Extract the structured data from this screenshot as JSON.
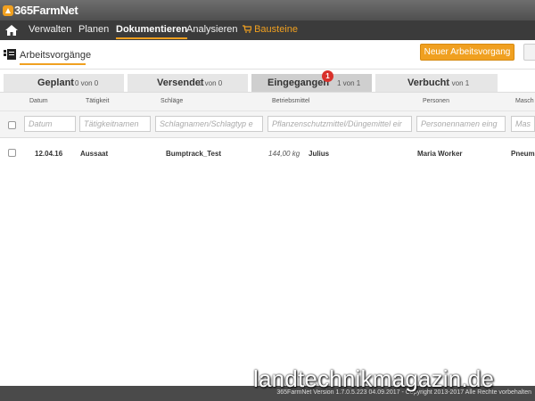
{
  "app": {
    "logo_text": "365FarmNet"
  },
  "nav": {
    "items": [
      {
        "label": "Verwalten"
      },
      {
        "label": "Planen"
      },
      {
        "label": "Dokumentieren",
        "active": true
      },
      {
        "label": "Analysieren"
      },
      {
        "label": "Bausteine",
        "icon": "cart-icon"
      }
    ],
    "home_icon": "home-icon",
    "accent": "#f0a020"
  },
  "subheader": {
    "title": "Arbeitsvorgänge",
    "icon": "documents-icon",
    "new_button": "Neuer Arbeitsvorgang"
  },
  "tabs": [
    {
      "label": "Geplant",
      "count": "0 von 0"
    },
    {
      "label": "Versendet",
      "count": "0 von 0"
    },
    {
      "label": "Eingegangen",
      "count": "1 von 1",
      "active": true,
      "badge": "1"
    },
    {
      "label": "Verbucht",
      "count": "1 von 1"
    }
  ],
  "table": {
    "columns": [
      "Datum",
      "Tätigkeit",
      "Schläge",
      "Betriebsmittel",
      "Personen",
      "Masch"
    ],
    "filters": [
      "Datum",
      "Tätigkeitnamen",
      "Schlagnamen/Schlagtyp e",
      "Pflanzenschutzmittel/Düngemittel eir",
      "Personennamen eing",
      "Masch"
    ],
    "rows": [
      {
        "date": "12.04.16",
        "activity": "Aussaat",
        "fields": "Bumptrack_Test",
        "amount": "144,00 kg",
        "resource": "Julius",
        "person": "Maria Worker",
        "machine": "Pneum"
      }
    ]
  },
  "footer": {
    "text": "365FarmNet Version 1.7.0.5.223 04.09.2017 - Copyright 2013-2017 Alle Rechte vorbehalten"
  },
  "watermark": "landtechnikmagazin.de"
}
